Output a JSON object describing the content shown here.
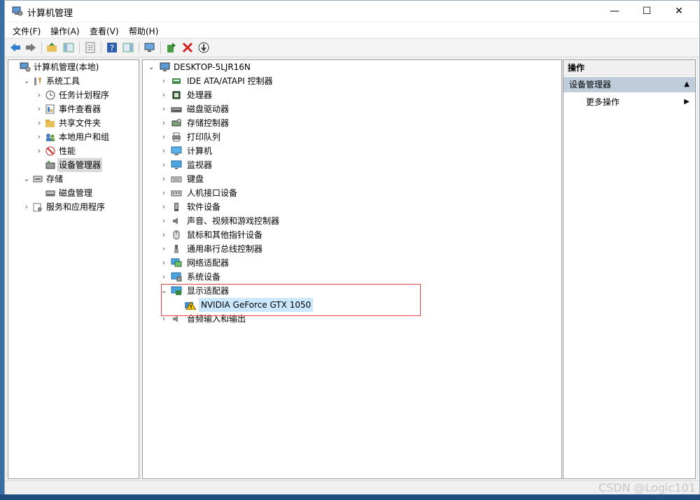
{
  "window": {
    "title": "计算机管理",
    "minimize": "—",
    "maximize": "☐",
    "close": "✕"
  },
  "menu": [
    "文件(F)",
    "操作(A)",
    "查看(V)",
    "帮助(H)"
  ],
  "left_tree": [
    {
      "label": "计算机管理(本地)",
      "indent": 0,
      "arrow": "",
      "icon": "computer-mgmt-icon"
    },
    {
      "label": "系统工具",
      "indent": 1,
      "arrow": "⌄",
      "icon": "tools-icon"
    },
    {
      "label": "任务计划程序",
      "indent": 2,
      "arrow": "›",
      "icon": "clock-icon"
    },
    {
      "label": "事件查看器",
      "indent": 2,
      "arrow": "›",
      "icon": "event-icon"
    },
    {
      "label": "共享文件夹",
      "indent": 2,
      "arrow": "›",
      "icon": "shared-folder-icon"
    },
    {
      "label": "本地用户和组",
      "indent": 2,
      "arrow": "›",
      "icon": "users-icon"
    },
    {
      "label": "性能",
      "indent": 2,
      "arrow": "›",
      "icon": "performance-icon"
    },
    {
      "label": "设备管理器",
      "indent": 2,
      "arrow": "",
      "icon": "device-manager-icon",
      "selected": true
    },
    {
      "label": "存储",
      "indent": 1,
      "arrow": "⌄",
      "icon": "storage-icon"
    },
    {
      "label": "磁盘管理",
      "indent": 2,
      "arrow": "",
      "icon": "disk-icon"
    },
    {
      "label": "服务和应用程序",
      "indent": 1,
      "arrow": "›",
      "icon": "services-icon"
    }
  ],
  "device_tree": {
    "root": "DESKTOP-5LJR16N",
    "categories": [
      {
        "label": "IDE ATA/ATAPI 控制器",
        "arrow": "›",
        "icon": "ide-icon"
      },
      {
        "label": "处理器",
        "arrow": "›",
        "icon": "cpu-icon"
      },
      {
        "label": "磁盘驱动器",
        "arrow": "›",
        "icon": "disk-drive-icon"
      },
      {
        "label": "存储控制器",
        "arrow": "›",
        "icon": "storage-controller-icon"
      },
      {
        "label": "打印队列",
        "arrow": "›",
        "icon": "printer-icon"
      },
      {
        "label": "计算机",
        "arrow": "›",
        "icon": "computer-icon"
      },
      {
        "label": "监视器",
        "arrow": "›",
        "icon": "monitor-icon"
      },
      {
        "label": "键盘",
        "arrow": "›",
        "icon": "keyboard-icon"
      },
      {
        "label": "人机接口设备",
        "arrow": "›",
        "icon": "hid-icon"
      },
      {
        "label": "软件设备",
        "arrow": "›",
        "icon": "software-device-icon"
      },
      {
        "label": "声音、视频和游戏控制器",
        "arrow": "›",
        "icon": "audio-icon"
      },
      {
        "label": "鼠标和其他指针设备",
        "arrow": "›",
        "icon": "mouse-icon"
      },
      {
        "label": "通用串行总线控制器",
        "arrow": "›",
        "icon": "usb-icon"
      },
      {
        "label": "网络适配器",
        "arrow": "›",
        "icon": "network-icon"
      },
      {
        "label": "系统设备",
        "arrow": "›",
        "icon": "system-device-icon"
      },
      {
        "label": "显示适配器",
        "arrow": "⌄",
        "icon": "display-adapter-icon"
      },
      {
        "label": "NVIDIA GeForce GTX 1050",
        "arrow": "",
        "icon": "warning-icon",
        "child": true,
        "selected": true
      },
      {
        "label": "音频输入和输出",
        "arrow": "›",
        "icon": "audio-io-icon"
      }
    ]
  },
  "ops": {
    "header": "操作",
    "section": "设备管理器",
    "more": "更多操作"
  },
  "watermark": "CSDN @Logic101",
  "colors": {
    "selection": "#cce8ff",
    "highlight_box": "#e04040",
    "ops_section": "#bfcddb"
  }
}
